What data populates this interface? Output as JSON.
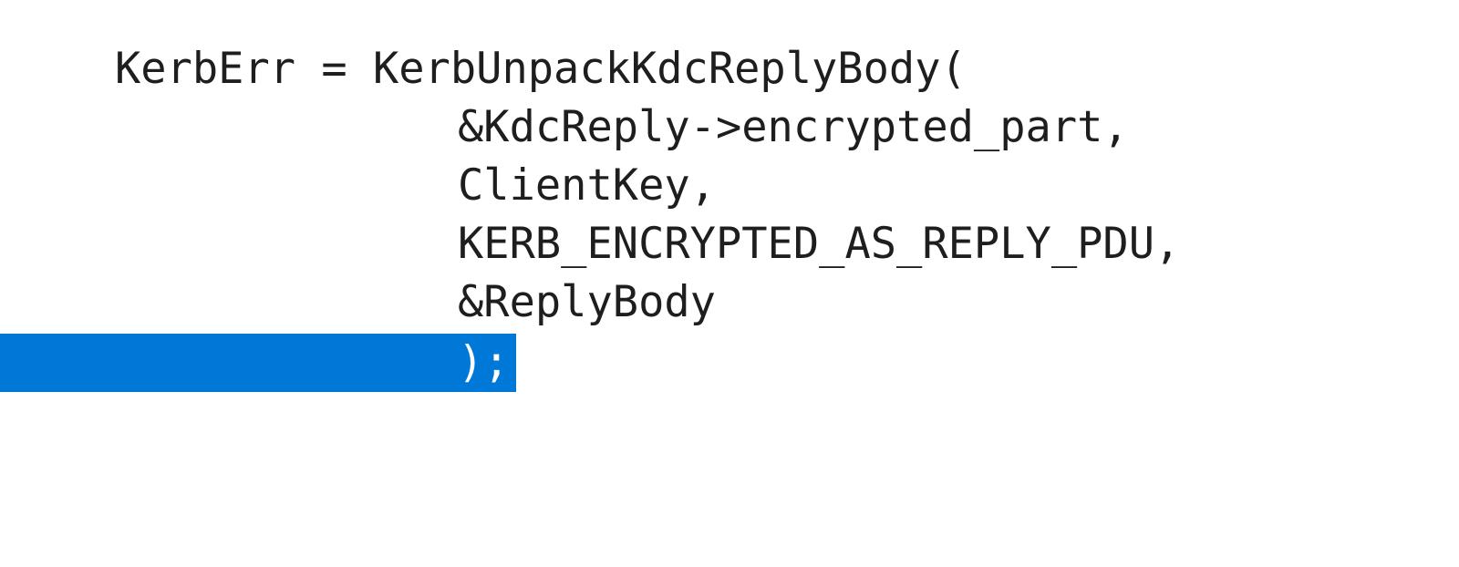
{
  "editor": {
    "selection_color": "#0078d7",
    "text_color": "#1e1e1e",
    "selected_text_color": "#ffffff",
    "lines": [
      {
        "text": "KerbErr = KerbUnpackKdcReplyBody("
      },
      {
        "text": "&KdcReply->encrypted_part,"
      },
      {
        "text": "ClientKey,"
      },
      {
        "text": "KERB_ENCRYPTED_AS_REPLY_PDU,"
      },
      {
        "text": "&ReplyBody"
      },
      {
        "text": ");"
      }
    ]
  }
}
